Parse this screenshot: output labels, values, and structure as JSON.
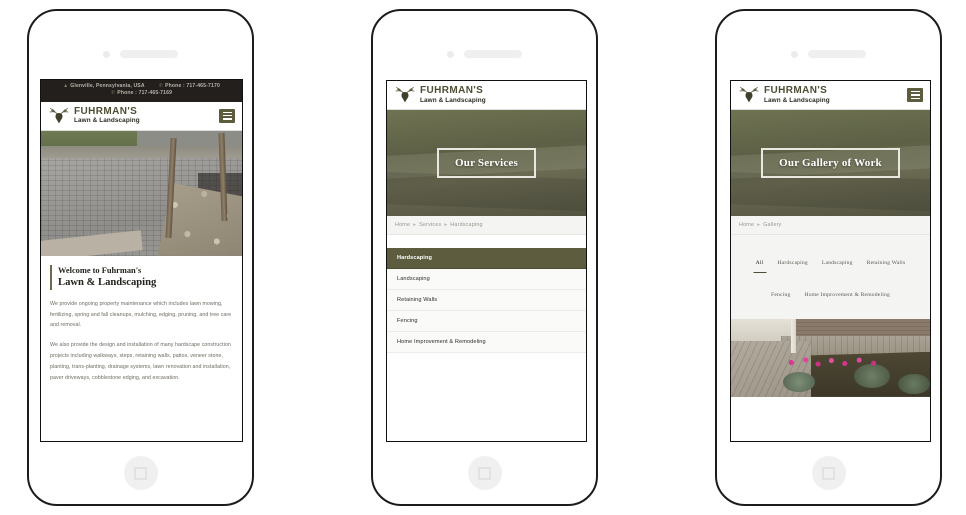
{
  "site": {
    "brand_name": "FUHRMAN'S",
    "brand_sub": "Lawn & Landscaping",
    "logo_icon": "deer-head-antlers-icon",
    "menu_icon": "hamburger-menu-icon",
    "colors": {
      "olive": "#5d5c3f",
      "dark_bar": "#221f1d",
      "light_panel": "#f4f4f2",
      "text": "#23221d"
    }
  },
  "phones": [
    {
      "id": "phone-home",
      "page": "home",
      "topbar": {
        "location_icon": "map-marker-icon",
        "location": "Glenville, Pennsylvania, USA",
        "phone_icon": "phone-icon",
        "phone1": "Phone : 717-465-7170",
        "phone2": "Phone : 717-465-7169"
      },
      "hero_photo_alt": "paver-patio-with-gravel-and-posts",
      "intro": {
        "line1": "Welcome to Fuhrman's",
        "line2": "Lawn & Landscaping",
        "paragraph1": "We provide ongoing property maintenance which includes lawn mowing, fertilizing, spring and fall cleanups, mulching, edging, pruning, and tree care and removal.",
        "paragraph2": "We also provide the design and installation of many hardscape construction projects including walkways, steps, retaining walls, patios, veneer stone, planting, trans-planting, drainage systems, lawn renovation and installation, paver driveways, cobblestone edging, and excavation."
      }
    },
    {
      "id": "phone-services",
      "page": "services",
      "hero_title": "Our Services",
      "hero_photo_alt": "olive-toned-landscape-banner",
      "breadcrumb": [
        "Home",
        "Services",
        "Hardscaping"
      ],
      "breadcrumb_separator": "▸",
      "services": [
        {
          "label": "Hardscaping",
          "active": true
        },
        {
          "label": "Landscaping",
          "active": false
        },
        {
          "label": "Retaining Walls",
          "active": false
        },
        {
          "label": "Fencing",
          "active": false
        },
        {
          "label": "Home Improvement & Remodeling",
          "active": false
        }
      ]
    },
    {
      "id": "phone-gallery",
      "page": "gallery",
      "hero_title": "Our Gallery of Work",
      "hero_photo_alt": "olive-toned-landscape-banner",
      "breadcrumb": [
        "Home",
        "Gallery"
      ],
      "breadcrumb_separator": "▸",
      "filters": [
        {
          "label": "All",
          "active": true
        },
        {
          "label": "Hardscaping",
          "active": false
        },
        {
          "label": "Landscaping",
          "active": false
        },
        {
          "label": "Retaining Walls",
          "active": false
        },
        {
          "label": "Fencing",
          "active": false
        },
        {
          "label": "Home Improvement & Remodeling",
          "active": false
        }
      ],
      "gallery_photo_alt": "flower-bed-with-pink-flowers-beside-paver-walkway"
    }
  ],
  "device": {
    "camera_icon": "front-camera-icon",
    "speaker_icon": "earpiece-speaker-icon",
    "home_button_icon": "home-button-icon"
  }
}
